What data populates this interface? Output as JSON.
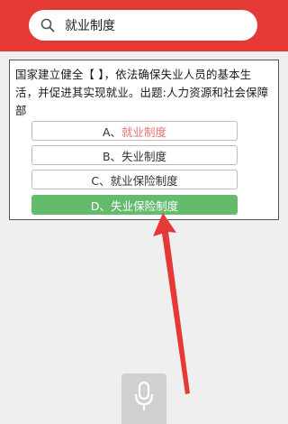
{
  "search": {
    "query": "就业制度"
  },
  "question": {
    "text": "国家建立健全【 】，依法确保失业人员的基本生活，并促进其实现就业。出题:人力资源和社会保障部"
  },
  "options": [
    {
      "prefix": "A、",
      "label": "就业制度"
    },
    {
      "prefix": "B、",
      "label": "失业制度"
    },
    {
      "prefix": "C、",
      "label": "就业保险制度"
    },
    {
      "prefix": "D、",
      "label": "失业保险制度"
    }
  ],
  "colors": {
    "header": "#e53935",
    "correct_option": "#64bb6c",
    "highlight_text": "#e57373",
    "arrow": "#e53935"
  },
  "icons": {
    "search": "search-icon",
    "microphone": "microphone-icon"
  }
}
